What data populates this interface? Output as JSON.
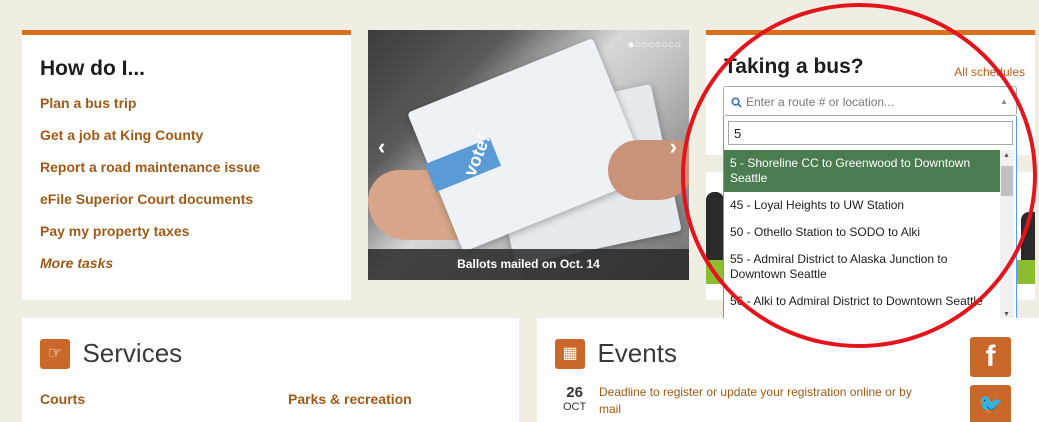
{
  "how_do_i": {
    "title": "How do I...",
    "links": [
      "Plan a bus trip",
      "Get a job at King County",
      "Report a road maintenance issue",
      "eFile Superior Court documents",
      "Pay my property taxes"
    ],
    "more": "More tasks"
  },
  "carousel": {
    "dots": "●○○○○○○○",
    "caption": "Ballots mailed on Oct. 14",
    "prev": "‹",
    "next": "›",
    "vote_text": "vote!"
  },
  "bus": {
    "title": "Taking a bus?",
    "all_schedules": "All schedules",
    "select_placeholder": "Enter a route # or location...",
    "search_value": "5",
    "options": [
      "5 - Shoreline CC to Greenwood to Downtown Seattle",
      "45 - Loyal Heights to UW Station",
      "50 - Othello Station to SODO to Alki",
      "55 - Admiral District to Alaska Junction to Downtown Seattle",
      "56 - Alki to Admiral District to Downtown Seattle"
    ],
    "highlighted_index": 0
  },
  "services": {
    "title": "Services",
    "icon": "hand-pointer-icon",
    "links": [
      "Courts",
      "Parks & recreation"
    ]
  },
  "events": {
    "title": "Events",
    "icon": "calendar-icon",
    "items": [
      {
        "day": "26",
        "month": "OCT",
        "text": "Deadline to register or update your registration online or by mail"
      }
    ]
  },
  "social": {
    "facebook": "f",
    "twitter": "🐦"
  },
  "colors": {
    "accent": "#d9701e",
    "link": "#a05a16",
    "highlight": "#4a7c4f",
    "annotation": "#e3141b"
  }
}
